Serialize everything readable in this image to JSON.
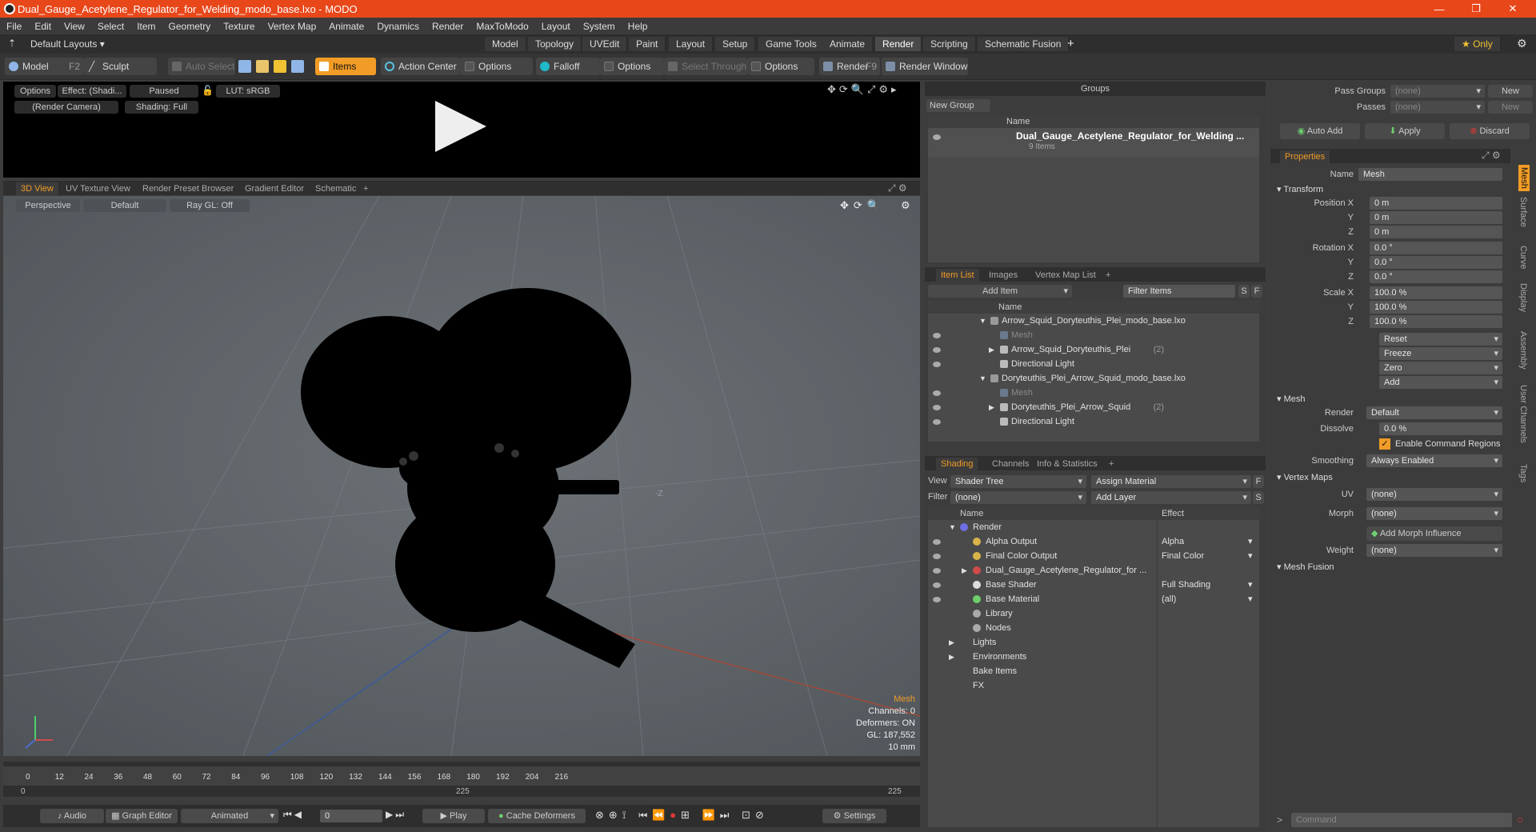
{
  "window": {
    "title": "Dual_Gauge_Acetylene_Regulator_for_Welding_modo_base.lxo - MODO",
    "min": "—",
    "max": "❐",
    "close": "✕"
  },
  "menu": [
    "File",
    "Edit",
    "View",
    "Select",
    "Item",
    "Geometry",
    "Texture",
    "Vertex Map",
    "Animate",
    "Dynamics",
    "Render",
    "MaxToModo",
    "Layout",
    "System",
    "Help"
  ],
  "layout": {
    "preset": "Default Layouts ▾",
    "tabs": [
      "Model",
      "Topology",
      "UVEdit",
      "Paint",
      "Layout",
      "Setup",
      "Game Tools",
      "Animate",
      "Render",
      "Scripting",
      "Schematic Fusion"
    ],
    "active": "Render",
    "add": "+",
    "only": "★  Only"
  },
  "toolbar": {
    "model": "Model",
    "model_key": "F2",
    "sculpt": "Sculpt",
    "auto_select": "Auto Select",
    "items": "Items",
    "action_center": "Action Center",
    "options1": "Options",
    "falloff": "Falloff",
    "options2": "Options",
    "select_through": "Select Through",
    "options3": "Options",
    "render": "Render",
    "render_key": "F9",
    "render_window": "Render Window"
  },
  "render_preview": {
    "options": "Options",
    "effect": "Effect: (Shadi...",
    "paused": "Paused",
    "lut": "LUT: sRGB",
    "camera": "(Render Camera)",
    "shading": "Shading: Full"
  },
  "viewport_tabs": [
    "3D View",
    "UV Texture View",
    "Render Preset Browser",
    "Gradient Editor",
    "Schematic",
    "+"
  ],
  "viewport": {
    "perspective": "Perspective",
    "default": "Default",
    "raygl": "Ray GL: Off",
    "info": {
      "mesh": "Mesh",
      "channels": "Channels: 0",
      "deformers": "Deformers: ON",
      "gl": "GL: 187,552",
      "scale": "10 mm"
    },
    "axis_z": "-Z"
  },
  "timeline": {
    "ticks": [
      "0",
      "12",
      "24",
      "36",
      "48",
      "60",
      "72",
      "84",
      "96",
      "108",
      "120",
      "132",
      "144",
      "156",
      "168",
      "180",
      "192",
      "204",
      "216"
    ],
    "start": "0",
    "mid": "225",
    "end": "225"
  },
  "bottom": {
    "audio": "Audio",
    "graph_editor": "Graph Editor",
    "animated": "Animated",
    "frame": "0",
    "play": "Play",
    "cache": "Cache Deformers",
    "settings": "Settings"
  },
  "groups": {
    "title": "Groups",
    "new_group": "New Group",
    "col_name": "Name",
    "item": "Dual_Gauge_Acetylene_Regulator_for_Welding ...",
    "count": "9 Items"
  },
  "item_list": {
    "tabs": [
      "Item List",
      "Images",
      "Vertex Map List",
      "+"
    ],
    "add_item": "Add Item",
    "filter": "Filter Items",
    "s": "S",
    "f": "F",
    "col_name": "Name",
    "rows": [
      {
        "label": "Arrow_Squid_Doryteuthis_Plei_modo_base.lxo",
        "indent": 0,
        "tri": "▼"
      },
      {
        "label": "Mesh",
        "indent": 1,
        "tri": "",
        "dim": true
      },
      {
        "label": "Arrow_Squid_Doryteuthis_Plei",
        "suffix": "(2)",
        "indent": 1,
        "tri": "▶"
      },
      {
        "label": "Directional Light",
        "indent": 1,
        "tri": ""
      },
      {
        "label": "Doryteuthis_Plei_Arrow_Squid_modo_base.lxo",
        "indent": 0,
        "tri": "▼"
      },
      {
        "label": "Mesh",
        "indent": 1,
        "tri": "",
        "dim": true
      },
      {
        "label": "Doryteuthis_Plei_Arrow_Squid",
        "suffix": "(2)",
        "indent": 1,
        "tri": "▶"
      },
      {
        "label": "Directional Light",
        "indent": 1,
        "tri": ""
      }
    ]
  },
  "shading": {
    "tabs": [
      "Shading",
      "Channels",
      "Info & Statistics",
      "+"
    ],
    "view_label": "View",
    "view": "Shader Tree",
    "assign": "Assign Material",
    "filter_label": "Filter",
    "filter": "(none)",
    "add_layer": "Add Layer",
    "f": "F",
    "s": "S",
    "col_name": "Name",
    "col_effect": "Effect",
    "rows": [
      {
        "label": "Render",
        "effect": "",
        "indent": 0,
        "tri": "▼"
      },
      {
        "label": "Alpha Output",
        "effect": "Alpha",
        "indent": 1
      },
      {
        "label": "Final Color Output",
        "effect": "Final Color",
        "indent": 1
      },
      {
        "label": "Dual_Gauge_Acetylene_Regulator_for ...",
        "effect": "",
        "indent": 1,
        "tri": "▶"
      },
      {
        "label": "Base Shader",
        "effect": "Full Shading",
        "indent": 1
      },
      {
        "label": "Base Material",
        "effect": "(all)",
        "indent": 1
      },
      {
        "label": "Library",
        "effect": "",
        "indent": 1
      },
      {
        "label": "Nodes",
        "effect": "",
        "indent": 1
      },
      {
        "label": "Lights",
        "effect": "",
        "indent": 0,
        "tri": "▶"
      },
      {
        "label": "Environments",
        "effect": "",
        "indent": 0,
        "tri": "▶"
      },
      {
        "label": "Bake Items",
        "effect": "",
        "indent": 0
      },
      {
        "label": "FX",
        "effect": "",
        "indent": 0
      }
    ]
  },
  "pass": {
    "pass_groups": "Pass Groups",
    "passes": "Passes",
    "none1": "(none)",
    "none2": "(none)",
    "new1": "New",
    "new2": "New",
    "auto_add": "Auto Add",
    "apply": "Apply",
    "discard": "Discard"
  },
  "properties": {
    "tab": "Properties",
    "name_label": "Name",
    "name": "Mesh",
    "transform": "Transform",
    "pos_label": "Position X",
    "pos": [
      "0 m",
      "0 m",
      "0 m"
    ],
    "rot_label": "Rotation X",
    "rot": [
      "0.0 °",
      "0.0 °",
      "0.0 °"
    ],
    "scale_label": "Scale X",
    "scale": [
      "100.0 %",
      "100.0 %",
      "100.0 %"
    ],
    "y": "Y",
    "z": "Z",
    "actions": [
      "Reset",
      "Freeze",
      "Zero",
      "Add"
    ],
    "mesh": "Mesh",
    "render_label": "Render",
    "render": "Default",
    "dissolve_label": "Dissolve",
    "dissolve": "0.0 %",
    "enable_cmd": "Enable Command Regions",
    "smoothing_label": "Smoothing",
    "smoothing": "Always Enabled",
    "vertex_maps": "Vertex Maps",
    "uv_label": "UV",
    "uv": "(none)",
    "morph_label": "Morph",
    "morph": "(none)",
    "add_morph": "Add Morph Influence",
    "weight_label": "Weight",
    "weight": "(none)",
    "mesh_fusion": "Mesh Fusion",
    "side_tabs": [
      "Mesh",
      "Surface",
      "Curve",
      "Display",
      "Assembly",
      "User Channels",
      "Tags"
    ]
  },
  "command": {
    "placeholder": "Command",
    "prompt": ">"
  }
}
